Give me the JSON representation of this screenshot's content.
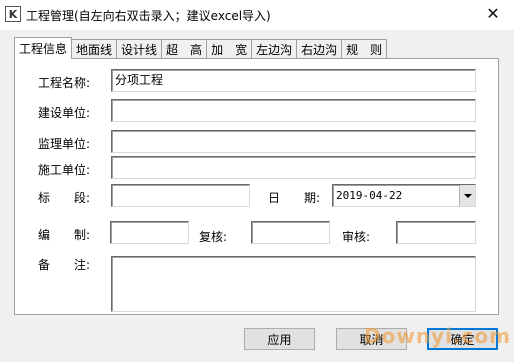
{
  "window": {
    "title": "工程管理(自左向右双击录入；建议excel导入)",
    "close_glyph": "✕",
    "icon_letter": "K"
  },
  "tabs": [
    "工程信息",
    "地面线",
    "设计线",
    "超　高",
    "加　宽",
    "左边沟",
    "右边沟",
    "规　则"
  ],
  "form": {
    "project_name_label": "工程名称:",
    "project_name_value": "分项工程",
    "builder_label": "建设单位:",
    "builder_value": "",
    "supervisor_label": "监理单位:",
    "supervisor_value": "",
    "contractor_label": "施工单位:",
    "contractor_value": "",
    "section_label": "标　　段:",
    "section_value": "",
    "date_label": "日　　期:",
    "date_value": "2019-04-22",
    "compiler_label": "编　　制:",
    "compiler_value": "",
    "reviewer_label": "复核:",
    "reviewer_value": "",
    "auditor_label": "审核:",
    "auditor_value": "",
    "remarks_label": "备　　注:",
    "remarks_value": ""
  },
  "buttons": {
    "apply": "应用",
    "cancel": "取消",
    "ok": "确定"
  },
  "watermark": "Downyi.com"
}
